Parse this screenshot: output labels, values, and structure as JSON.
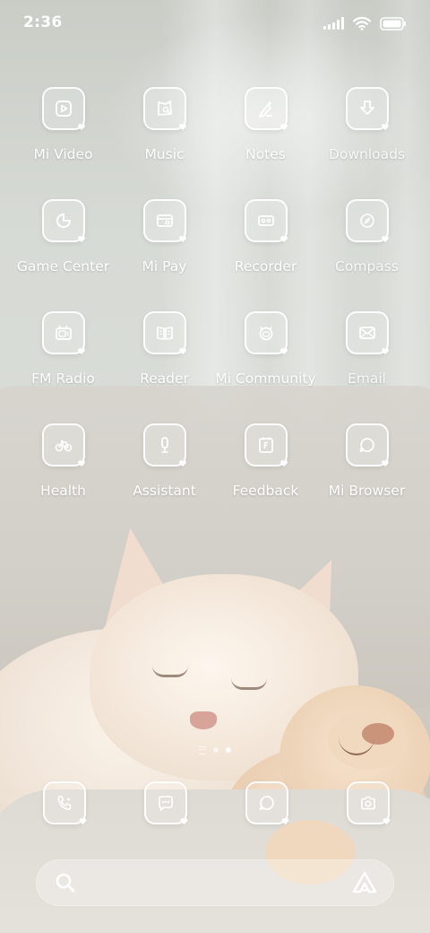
{
  "status_bar": {
    "time": "2:36"
  },
  "apps": [
    {
      "label": "Mi Video",
      "icon": "video-icon"
    },
    {
      "label": "Music",
      "icon": "music-icon"
    },
    {
      "label": "Notes",
      "icon": "notes-icon"
    },
    {
      "label": "Downloads",
      "icon": "downloads-icon"
    },
    {
      "label": "Game Center",
      "icon": "game-center-icon"
    },
    {
      "label": "Mi Pay",
      "icon": "wallet-icon"
    },
    {
      "label": "Recorder",
      "icon": "recorder-icon"
    },
    {
      "label": "Compass",
      "icon": "compass-icon"
    },
    {
      "label": "FM Radio",
      "icon": "radio-icon"
    },
    {
      "label": "Reader",
      "icon": "book-icon"
    },
    {
      "label": "Mi Community",
      "icon": "community-icon"
    },
    {
      "label": "Email",
      "icon": "mail-icon"
    },
    {
      "label": "Health",
      "icon": "bicycle-icon"
    },
    {
      "label": "Assistant",
      "icon": "microphone-icon"
    },
    {
      "label": "Feedback",
      "icon": "feedback-icon"
    },
    {
      "label": "Mi Browser",
      "icon": "browser-icon"
    }
  ],
  "pager": {
    "pages": 2,
    "current": 2
  },
  "dock": [
    {
      "icon": "phone-icon"
    },
    {
      "icon": "messages-icon"
    },
    {
      "icon": "browser-icon"
    },
    {
      "icon": "camera-icon"
    }
  ],
  "search_bar": {
    "left_icon": "search-icon",
    "right_icon": "assistant-icon"
  },
  "colors": {
    "icon_stroke": "#ffffff",
    "label": "#ffffff"
  }
}
